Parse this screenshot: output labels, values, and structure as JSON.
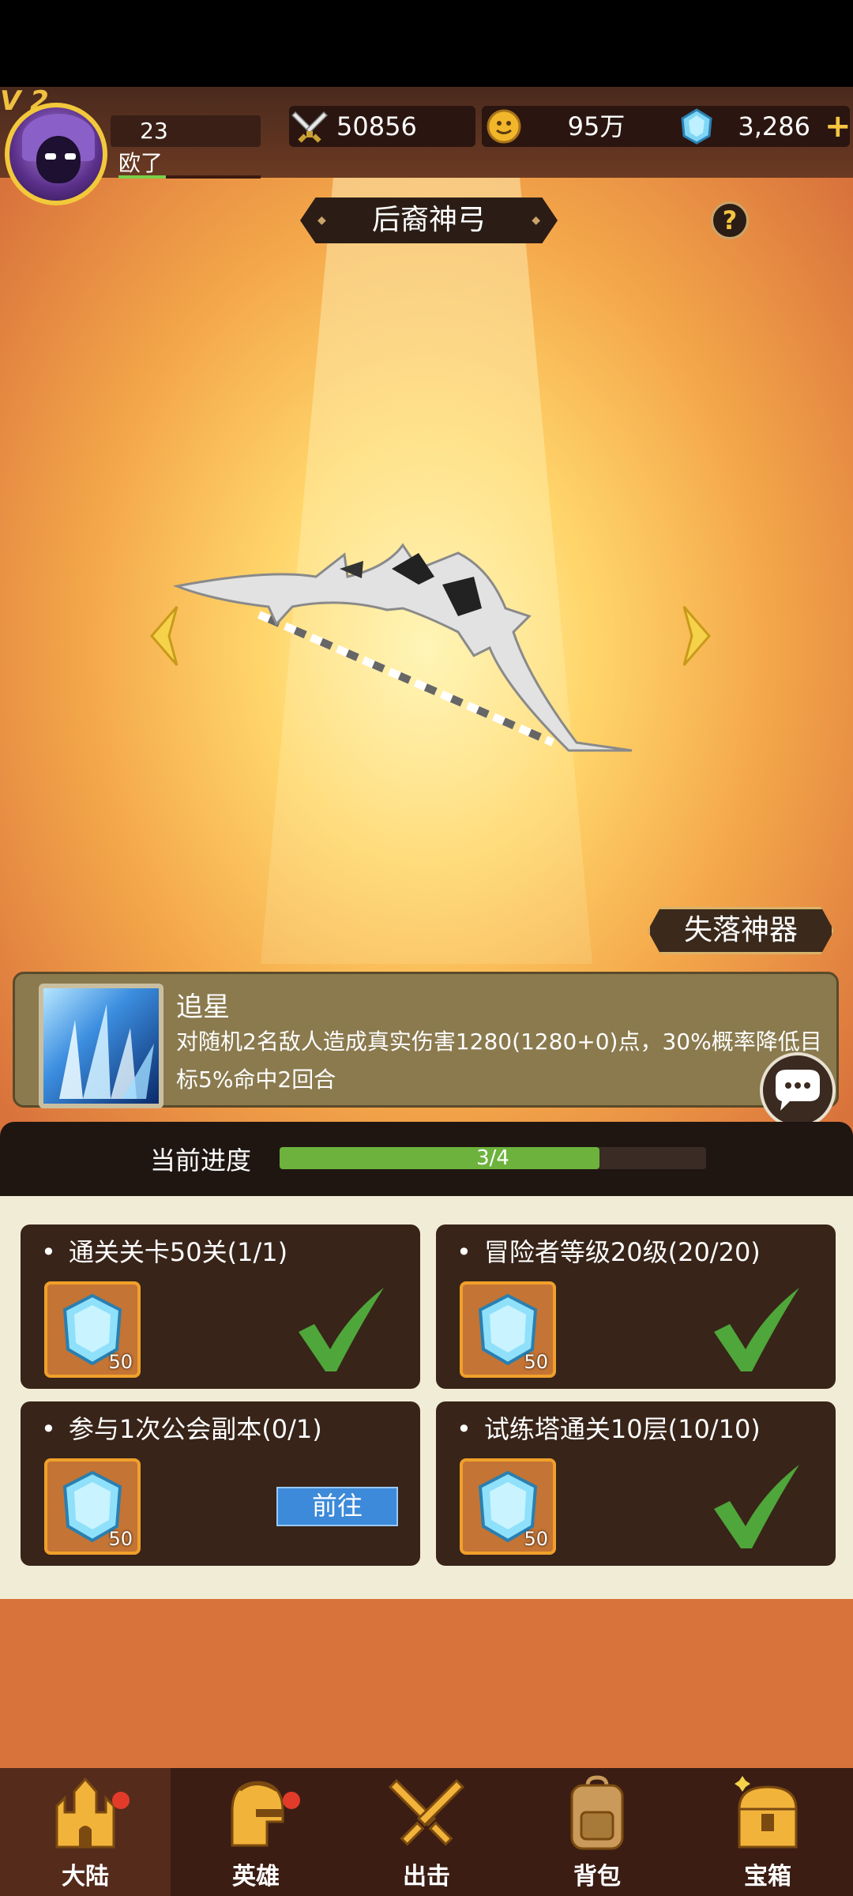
{
  "header": {
    "vip": "V 2",
    "level": "23",
    "player_name": "欧了",
    "power": "50856",
    "gold": "95万",
    "gems": "3,286",
    "plus": "+"
  },
  "artifact": {
    "title": "后裔神弓",
    "help_symbol": "?",
    "category": "失落神器"
  },
  "skill": {
    "name": "追星",
    "description": "对随机2名敌人造成真实伤害1280(1280+0)点，30%概率降低目标5%命中2回合"
  },
  "progress": {
    "label": "当前进度",
    "text": "3/4",
    "fraction": 0.75
  },
  "tasks": [
    {
      "name": "通关关卡50关(1/1)",
      "reward_qty": "50",
      "done": true
    },
    {
      "name": "冒险者等级20级(20/20)",
      "reward_qty": "50",
      "done": true
    },
    {
      "name": "参与1次公会副本(0/1)",
      "reward_qty": "50",
      "done": false,
      "action": "前往"
    },
    {
      "name": "试练塔通关10层(10/10)",
      "reward_qty": "50",
      "done": true
    }
  ],
  "nav": [
    {
      "label": "大陆",
      "icon": "castle-icon",
      "badge": true,
      "active": true
    },
    {
      "label": "英雄",
      "icon": "helmet-icon",
      "badge": true,
      "active": false
    },
    {
      "label": "出击",
      "icon": "crossed-swords-icon",
      "badge": false,
      "active": false
    },
    {
      "label": "背包",
      "icon": "backpack-icon",
      "badge": false,
      "active": false
    },
    {
      "label": "宝箱",
      "icon": "treasure-chest-icon",
      "badge": false,
      "active": false
    }
  ],
  "colors": {
    "accent_gold": "#f5c542",
    "progress_green": "#6cb23c",
    "check_green": "#4fa63a",
    "button_blue": "#3c8ad9"
  }
}
